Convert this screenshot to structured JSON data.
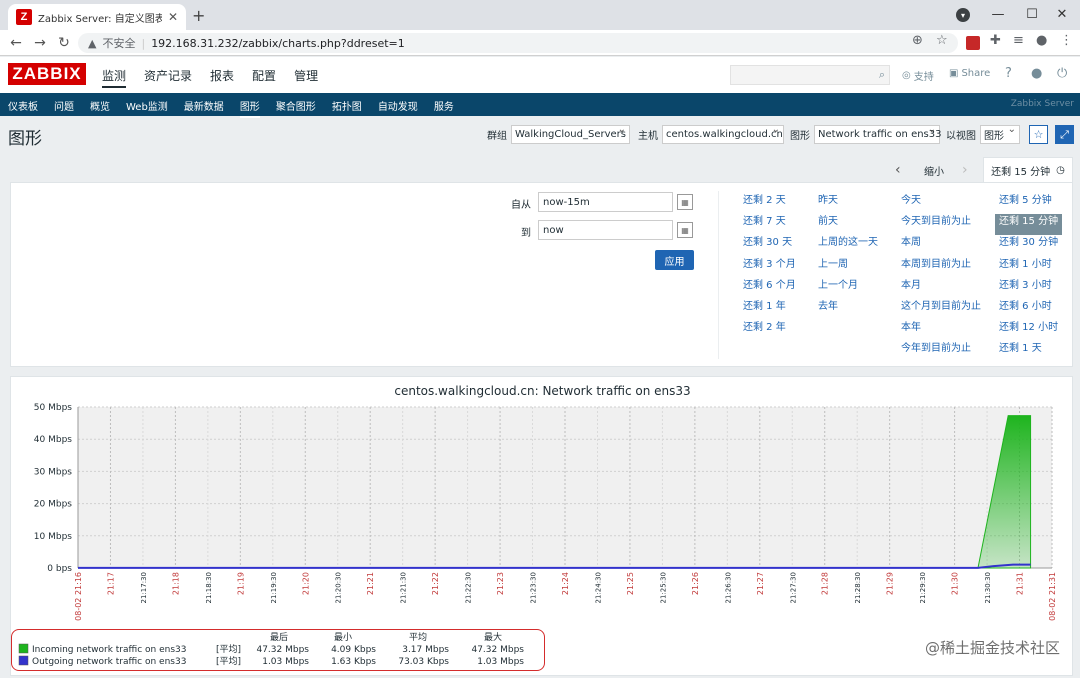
{
  "browser": {
    "tab_title": "Zabbix Server: 自定义图表 [每...",
    "insecure_label": "不安全",
    "url": "192.168.31.232/zabbix/charts.php?ddreset=1"
  },
  "zabbix": {
    "logo": "ZABBIX",
    "topnav": [
      "监测",
      "资产记录",
      "报表",
      "配置",
      "管理"
    ],
    "support": "支持",
    "share": "Share",
    "help": "?",
    "subnav": [
      "仪表板",
      "问题",
      "概览",
      "Web监测",
      "最新数据",
      "图形",
      "聚合图形",
      "拓扑图",
      "自动发现",
      "服务"
    ],
    "subnav_right": "Zabbix Server"
  },
  "page": {
    "title": "图形",
    "group_label": "群组",
    "group_value": "WalkingCloud_Servers",
    "host_label": "主机",
    "host_value": "centos.walkingcloud.cn",
    "graph_label": "图形",
    "graph_value": "Network traffic on ens33",
    "view_label": "以视图",
    "view_value": "图形"
  },
  "time": {
    "zoom_out": "缩小",
    "range_tab": "还剩 15 分钟",
    "from_label": "自从",
    "from_value": "now-15m",
    "to_label": "到",
    "to_value": "now",
    "apply": "应用",
    "quick": [
      [
        "还剩 2 天",
        "还剩 7 天",
        "还剩 30 天",
        "还剩 3 个月",
        "还剩 6 个月",
        "还剩 1 年",
        "还剩 2 年"
      ],
      [
        "昨天",
        "前天",
        "上周的这一天",
        "上一周",
        "上一个月",
        "去年"
      ],
      [
        "今天",
        "今天到目前为止",
        "本周",
        "本周到目前为止",
        "本月",
        "这个月到目前为止",
        "本年",
        "今年到目前为止"
      ],
      [
        "还剩 5 分钟",
        "还剩 15 分钟",
        "还剩 30 分钟",
        "还剩 1 小时",
        "还剩 3 小时",
        "还剩 6 小时",
        "还剩 12 小时",
        "还剩 1 天"
      ]
    ],
    "selected_quick": "还剩 15 分钟"
  },
  "chart_data": {
    "type": "area",
    "title": "centos.walkingcloud.cn: Network traffic on ens33",
    "y_ticks": [
      "50 Mbps",
      "40 Mbps",
      "30 Mbps",
      "20 Mbps",
      "10 Mbps",
      "0 bps"
    ],
    "ylim": [
      0,
      50
    ],
    "y_unit": "Mbps",
    "x_labels": [
      "08-02 21:16",
      "21:17",
      "21:17:30",
      "21:18",
      "21:18:30",
      "21:19",
      "21:19:30",
      "21:20",
      "21:20:30",
      "21:21",
      "21:21:30",
      "21:22",
      "21:22:30",
      "21:23",
      "21:23:30",
      "21:24",
      "21:24:30",
      "21:25",
      "21:25:30",
      "21:26",
      "21:26:30",
      "21:27",
      "21:27:30",
      "21:28",
      "21:28:30",
      "21:29",
      "21:29:30",
      "21:30",
      "21:30:30",
      "21:31",
      "08-02 21:31"
    ],
    "x_major": [
      true,
      true,
      false,
      true,
      false,
      true,
      false,
      true,
      false,
      true,
      false,
      true,
      false,
      true,
      false,
      true,
      false,
      true,
      false,
      true,
      false,
      true,
      false,
      true,
      false,
      true,
      false,
      true,
      false,
      true,
      true
    ],
    "series": [
      {
        "name": "Incoming network traffic on ens33",
        "color": "#1eb41e",
        "points": [
          [
            0,
            0.0
          ],
          [
            0.924,
            0.0
          ],
          [
            0.955,
            47.32
          ],
          [
            0.978,
            47.32
          ],
          [
            0.978,
            0.0
          ]
        ]
      },
      {
        "name": "Outgoing network traffic on ens33",
        "color": "#3333cc",
        "points": [
          [
            0,
            0.05
          ],
          [
            0.924,
            0.05
          ],
          [
            0.94,
            0.6
          ],
          [
            0.96,
            1.03
          ],
          [
            0.978,
            1.03
          ]
        ]
      }
    ],
    "legend_header": [
      "最后",
      "最小",
      "平均",
      "最大"
    ],
    "legend_rows": [
      {
        "name": "Incoming network traffic on ens33",
        "fn": "[平均]",
        "last": "47.32 Mbps",
        "min": "4.09 Kbps",
        "avg": "3.17 Mbps",
        "max": "47.32 Mbps"
      },
      {
        "name": "Outgoing network traffic on ens33",
        "fn": "[平均]",
        "last": "1.03 Mbps",
        "min": "1.63 Kbps",
        "avg": "73.03 Kbps",
        "max": "1.03 Mbps"
      }
    ]
  },
  "watermark": "@稀土掘金技术社区"
}
